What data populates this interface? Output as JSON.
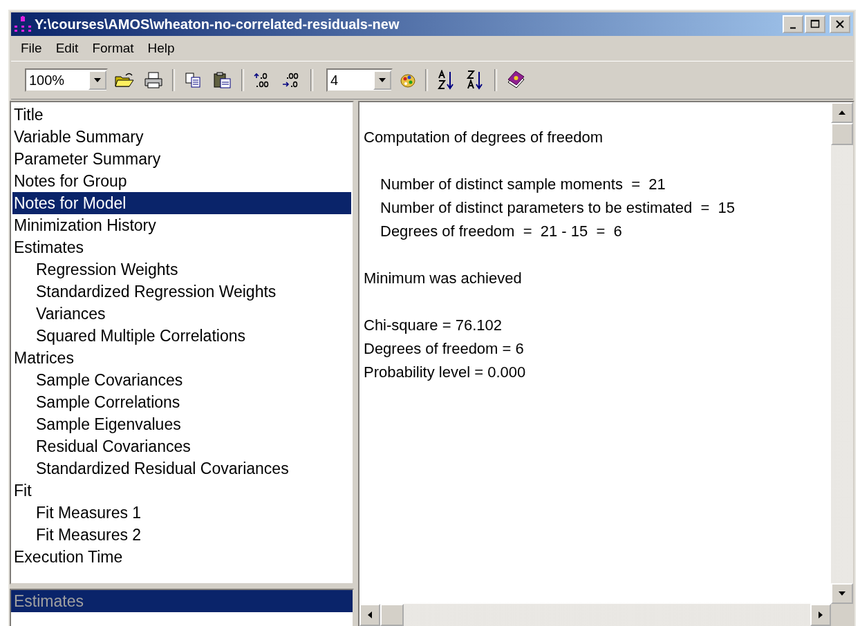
{
  "window": {
    "title": "Y:\\courses\\AMOS\\wheaton-no-correlated-residuals-new"
  },
  "menu": [
    "File",
    "Edit",
    "Format",
    "Help"
  ],
  "toolbar": {
    "zoom": "100%",
    "decimals": "4"
  },
  "tree": [
    {
      "label": "Title",
      "selected": false
    },
    {
      "label": "Variable Summary",
      "selected": false
    },
    {
      "label": "Parameter Summary",
      "selected": false
    },
    {
      "label": "Notes for Group",
      "selected": false
    },
    {
      "label": "Notes for Model",
      "selected": true
    },
    {
      "label": "Minimization History",
      "selected": false
    },
    {
      "label": "Estimates",
      "selected": false,
      "children": [
        {
          "label": "Regression Weights",
          "selected": false
        },
        {
          "label": "Standardized Regression Weights",
          "selected": false
        },
        {
          "label": "Variances",
          "selected": false
        },
        {
          "label": "Squared Multiple Correlations",
          "selected": false
        }
      ]
    },
    {
      "label": "Matrices",
      "selected": false,
      "children": [
        {
          "label": "Sample Covariances",
          "selected": false
        },
        {
          "label": "Sample Correlations",
          "selected": false
        },
        {
          "label": "Sample Eigenvalues",
          "selected": false
        },
        {
          "label": "Residual Covariances",
          "selected": false
        },
        {
          "label": "Standardized Residual Covariances",
          "selected": false
        }
      ]
    },
    {
      "label": "Fit",
      "selected": false,
      "children": [
        {
          "label": "Fit Measures 1",
          "selected": false
        },
        {
          "label": "Fit Measures 2",
          "selected": false
        }
      ]
    },
    {
      "label": "Execution Time",
      "selected": false
    }
  ],
  "group_list": [
    {
      "label": "Estimates",
      "selected": true
    }
  ],
  "output": [
    {
      "indented": false,
      "lines": [
        "Computation of degrees of freedom"
      ]
    },
    {
      "indented": true,
      "lines": [
        "Number of distinct sample moments  =  21",
        "Number of distinct parameters to be estimated  =  15",
        "Degrees of freedom  =  21 - 15  =  6"
      ]
    },
    {
      "indented": false,
      "lines": [
        "Minimum was achieved"
      ]
    },
    {
      "indented": false,
      "lines": [
        "Chi-square = 76.102",
        "Degrees of freedom = 6",
        "Probability level = 0.000"
      ]
    }
  ]
}
